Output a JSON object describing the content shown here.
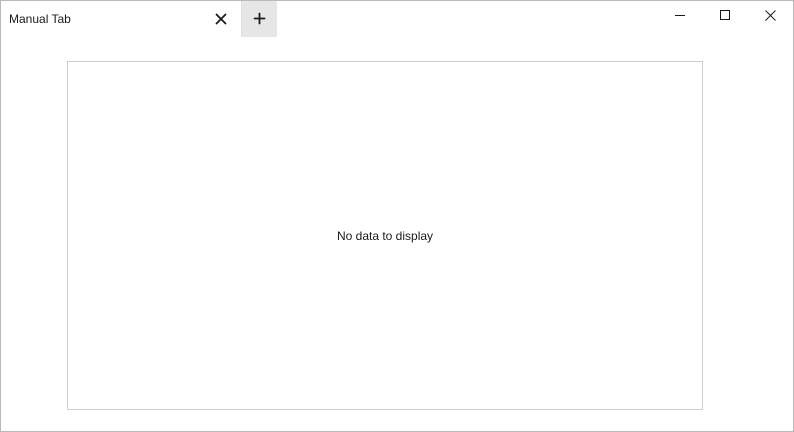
{
  "tab": {
    "title": "Manual Tab",
    "close_icon": "close-icon",
    "new_tab_icon": "plus-icon"
  },
  "window_controls": {
    "minimize_icon": "minimize-icon",
    "maximize_icon": "maximize-icon",
    "close_icon": "close-icon"
  },
  "content": {
    "empty_message": "No data to display"
  },
  "colors": {
    "new_tab_background": "#e6e6e6",
    "panel_border": "#cfcfcf",
    "window_border": "#b9b9b9"
  }
}
